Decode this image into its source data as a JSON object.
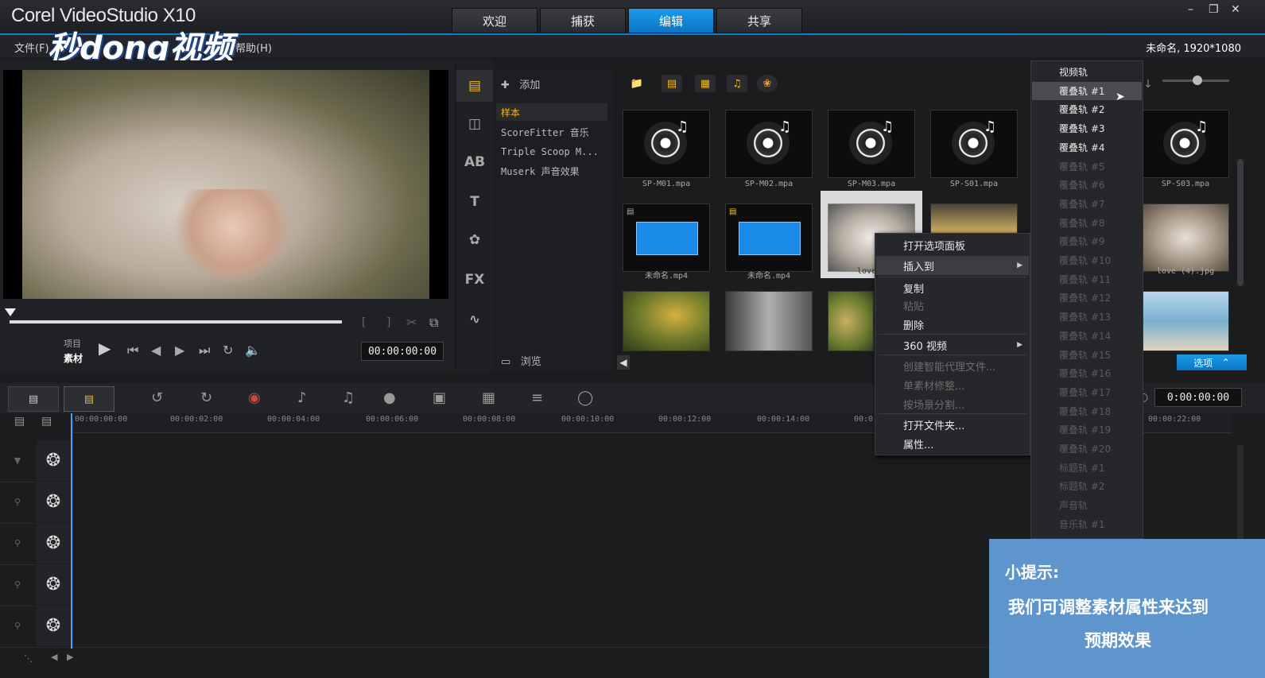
{
  "app": {
    "title": "Corel VideoStudio X10"
  },
  "tabs": [
    {
      "label": "欢迎"
    },
    {
      "label": "捕获"
    },
    {
      "label": "编辑"
    },
    {
      "label": "共享"
    }
  ],
  "menu": {
    "file": "文件(F)",
    "help": "帮助(H)",
    "watermark": "秒dong视频"
  },
  "project_info": "未命名, 1920*1080",
  "preview": {
    "label_project": "项目",
    "label_clip": "素材",
    "timecode": "00:00:00:00"
  },
  "library": {
    "add_label": "添加",
    "browse_label": "浏览",
    "folders": [
      {
        "label": "样本"
      },
      {
        "label": "ScoreFitter 音乐"
      },
      {
        "label": "Triple Scoop M..."
      },
      {
        "label": "Muserk 声音效果"
      }
    ],
    "thumbnails": [
      {
        "label": "SP-M01.mpa"
      },
      {
        "label": "SP-M02.mpa"
      },
      {
        "label": "SP-M03.mpa"
      },
      {
        "label": "SP-S01.mpa"
      },
      {
        "label": "SP-S03.mpa"
      },
      {
        "label": "未命名.mp4"
      },
      {
        "label": "未命名.mp4"
      },
      {
        "label": "love ("
      },
      {
        "label": "love (4).jpg"
      }
    ],
    "options_label": "选项"
  },
  "timeline": {
    "timecode": "0:00:00:00",
    "ruler": [
      "00:00:00:00",
      "00:00:02:00",
      "00:00:04:00",
      "00:00:06:00",
      "00:00:08:00",
      "00:00:10:00",
      "00:00:12:00",
      "00:00:14:00",
      "00:0",
      "00:00:22:00"
    ]
  },
  "context_menu": {
    "items": [
      {
        "label": "打开选项面板"
      },
      {
        "label": "插入到"
      },
      {
        "label": "复制"
      },
      {
        "label": "粘贴"
      },
      {
        "label": "删除"
      },
      {
        "label": "360 视频"
      },
      {
        "label": "创建智能代理文件..."
      },
      {
        "label": "单素材修整..."
      },
      {
        "label": "按场景分割..."
      },
      {
        "label": "打开文件夹..."
      },
      {
        "label": "属性..."
      }
    ]
  },
  "submenu": {
    "items": [
      {
        "label": "视频轨"
      },
      {
        "label": "覆叠轨 #1"
      },
      {
        "label": "覆叠轨 #2"
      },
      {
        "label": "覆叠轨 #3"
      },
      {
        "label": "覆叠轨 #4"
      },
      {
        "label": "覆叠轨 #5"
      },
      {
        "label": "覆叠轨 #6"
      },
      {
        "label": "覆叠轨 #7"
      },
      {
        "label": "覆叠轨 #8"
      },
      {
        "label": "覆叠轨 #9"
      },
      {
        "label": "覆叠轨 #10"
      },
      {
        "label": "覆叠轨 #11"
      },
      {
        "label": "覆叠轨 #12"
      },
      {
        "label": "覆叠轨 #13"
      },
      {
        "label": "覆叠轨 #14"
      },
      {
        "label": "覆叠轨 #15"
      },
      {
        "label": "覆叠轨 #16"
      },
      {
        "label": "覆叠轨 #17"
      },
      {
        "label": "覆叠轨 #18"
      },
      {
        "label": "覆叠轨 #19"
      },
      {
        "label": "覆叠轨 #20"
      },
      {
        "label": "标题轨 #1"
      },
      {
        "label": "标题轨 #2"
      },
      {
        "label": "声音轨"
      },
      {
        "label": "音乐轨 #1"
      }
    ]
  },
  "hint": {
    "title": "小提示:",
    "line1": "我们可调整素材属性来达到",
    "line2": "预期效果"
  },
  "colors": {
    "accent": "#0b75c4",
    "highlight": "#f3b71a"
  }
}
